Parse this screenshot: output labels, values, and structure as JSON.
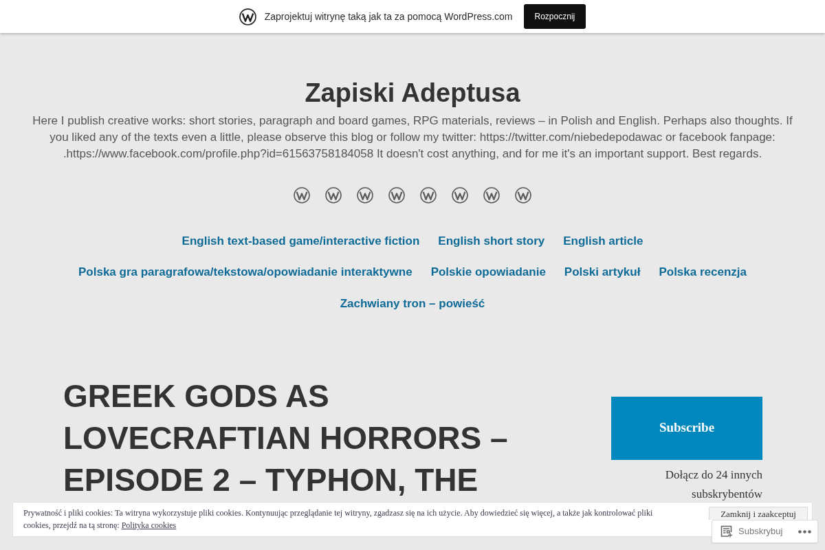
{
  "top_bar": {
    "text": "Zaprojektuj witrynę taką jak ta za pomocą WordPress.com",
    "button": "Rozpocznij"
  },
  "header": {
    "title": "Zapiski Adeptusa",
    "description": "Here I publish creative works: short stories, paragraph and board games, RPG materials, reviews – in Polish and English. Perhaps also thoughts. If you liked any of the texts even a little, please observe this blog or follow my twitter: https://twitter.com/niebedepodawac or facebook fanpage: .https://www.facebook.com/profile.php?id=61563758184058 It doesn't cost anything, and for me it's an important support. Best regards."
  },
  "menu": {
    "rows": [
      {
        "items": [
          "English text-based game/interactive fiction",
          "English short story",
          "English article"
        ]
      },
      {
        "items": [
          "Polska gra paragrafowa/tekstowa/opowiadanie interaktywne",
          "Polskie opowiadanie",
          "Polski artykuł",
          "Polska recenzja"
        ]
      },
      {
        "items": [
          "Zachwiany tron – powieść"
        ]
      }
    ]
  },
  "article": {
    "title": "GREEK GODS AS LOVECRAFTIAN HORRORS – EPISODE 2 – TYPHON, THE"
  },
  "sidebar": {
    "subscribe_button": "Subscribe",
    "subscribers_text": "Dołącz do 24 innych subskrybentów"
  },
  "cookie_banner": {
    "text": "Prywatność i pliki cookies: Ta witryna wykorzystuje pliki cookies. Kontynuując przeglądanie tej witryny, zgadzasz się na ich użycie. Aby dowiedzieć się więcej, a także jak kontrolować pliki cookies, przejdź na tą stronę: ",
    "link": "Polityka cookies",
    "button": "Zamknij i zaakceptuj"
  },
  "follow_bar": {
    "label": "Subskrybuj"
  }
}
